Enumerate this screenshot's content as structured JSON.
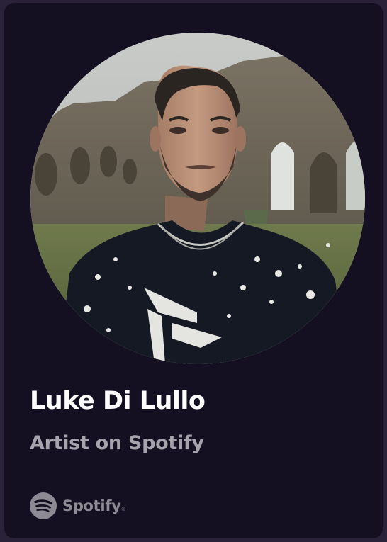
{
  "card": {
    "artist_name": "Luke Di Lullo",
    "subtitle": "Artist on Spotify",
    "brand": {
      "icon": "spotify-logo-icon",
      "wordmark": "Spotify",
      "trademark": "®"
    }
  },
  "colors": {
    "background": "#2a2238",
    "card": "#141021",
    "name_text": "#ffffff",
    "subtitle_text": "#a7a3ad",
    "brand_gray": "#8e8a94"
  }
}
